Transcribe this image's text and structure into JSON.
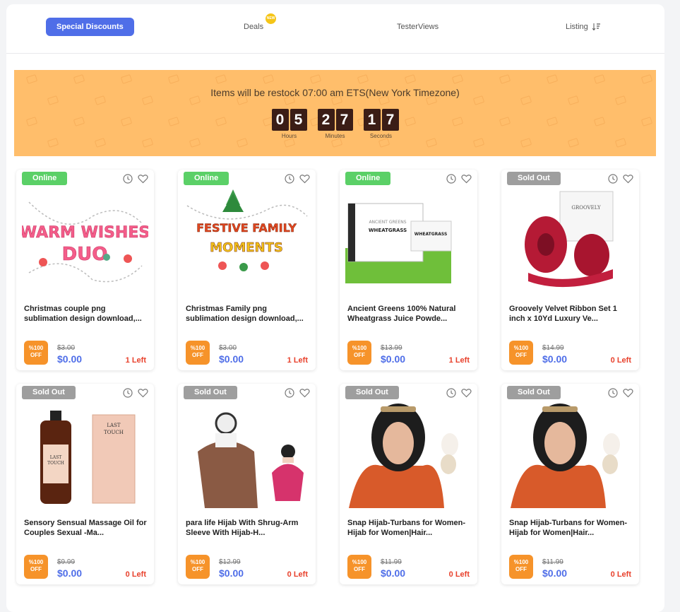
{
  "tabs": [
    {
      "label": "Special Discounts",
      "active": true
    },
    {
      "label": "Deals",
      "badge": "NEW"
    },
    {
      "label": "TesterViews"
    },
    {
      "label": "Listing"
    }
  ],
  "banner": {
    "message": "Items will be restock 07:00 am ETS(New York Timezone)",
    "timer": {
      "hours": [
        "0",
        "5"
      ],
      "minutes": [
        "2",
        "7"
      ],
      "seconds": [
        "1",
        "7"
      ],
      "hours_label": "Hours",
      "minutes_label": "Minutes",
      "seconds_label": "Seconds"
    }
  },
  "products": [
    {
      "status": "Online",
      "title": "Christmas couple png sublimation design download,...",
      "discount_top": "%100",
      "discount_bottom": "OFF",
      "old_price": "$3.00",
      "price": "$0.00",
      "left": "1 Left",
      "image": "warm-wishes-design"
    },
    {
      "status": "Online",
      "title": "Christmas Family png sublimation design download,...",
      "discount_top": "%100",
      "discount_bottom": "OFF",
      "old_price": "$3.00",
      "price": "$0.00",
      "left": "1 Left",
      "image": "festive-family-design"
    },
    {
      "status": "Online",
      "title": "Ancient Greens 100% Natural Wheatgrass Juice Powde...",
      "discount_top": "%100",
      "discount_bottom": "OFF",
      "old_price": "$13.99",
      "price": "$0.00",
      "left": "1 Left",
      "image": "wheatgrass-box"
    },
    {
      "status": "Sold Out",
      "title": "Groovely Velvet Ribbon Set 1 inch x 10Yd Luxury Ve...",
      "discount_top": "%100",
      "discount_bottom": "OFF",
      "old_price": "$14.99",
      "price": "$0.00",
      "left": "0 Left",
      "image": "velvet-ribbon"
    },
    {
      "status": "Sold Out",
      "title": "Sensory Sensual Massage Oil for Couples Sexual -Ma...",
      "discount_top": "%100",
      "discount_bottom": "OFF",
      "old_price": "$9.99",
      "price": "$0.00",
      "left": "0 Left",
      "image": "massage-oil"
    },
    {
      "status": "Sold Out",
      "title": "para life Hijab With Shrug-Arm Sleeve With Hijab-H...",
      "discount_top": "%100",
      "discount_bottom": "OFF",
      "old_price": "$12.99",
      "price": "$0.00",
      "left": "0 Left",
      "image": "hijab-shrug"
    },
    {
      "status": "Sold Out",
      "title": "Snap Hijab-Turbans for Women-Hijab for Women|Hair...",
      "discount_top": "%100",
      "discount_bottom": "OFF",
      "old_price": "$11.99",
      "price": "$0.00",
      "left": "0 Left",
      "image": "snap-hijab"
    },
    {
      "status": "Sold Out",
      "title": "Snap Hijab-Turbans for Women-Hijab for Women|Hair...",
      "discount_top": "%100",
      "discount_bottom": "OFF",
      "old_price": "$11.99",
      "price": "$0.00",
      "left": "0 Left",
      "image": "snap-hijab"
    }
  ],
  "colors": {
    "accent": "#4f6ee8",
    "banner": "#ffbe6b",
    "online": "#5bd067",
    "sold_out": "#9e9e9e",
    "discount": "#f6932a",
    "left": "#e8412c"
  }
}
